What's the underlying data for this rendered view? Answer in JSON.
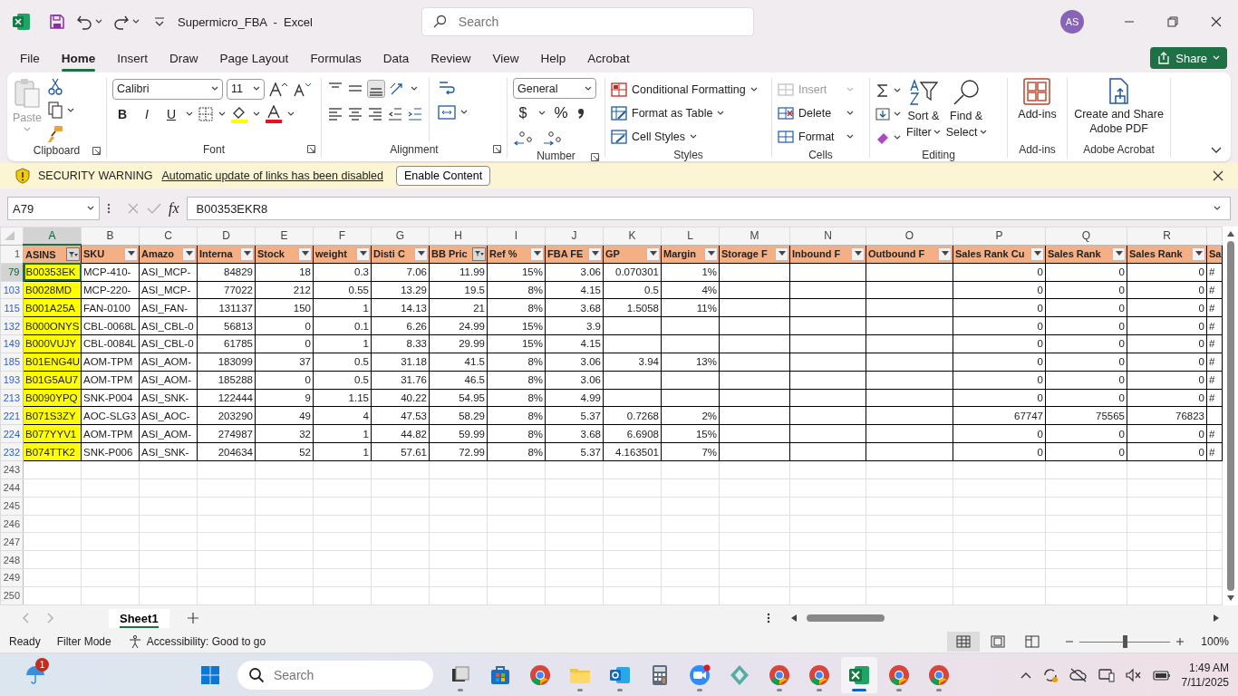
{
  "title_bar": {
    "title": "Supermicro_FBA  -  Excel",
    "search_placeholder": "Search",
    "avatar": "AS"
  },
  "menu_tabs": [
    {
      "label": "File",
      "selected": false
    },
    {
      "label": "Home",
      "selected": true
    },
    {
      "label": "Insert",
      "selected": false
    },
    {
      "label": "Draw",
      "selected": false
    },
    {
      "label": "Page Layout",
      "selected": false
    },
    {
      "label": "Formulas",
      "selected": false
    },
    {
      "label": "Data",
      "selected": false
    },
    {
      "label": "Review",
      "selected": false
    },
    {
      "label": "View",
      "selected": false
    },
    {
      "label": "Help",
      "selected": false
    },
    {
      "label": "Acrobat",
      "selected": false
    }
  ],
  "share_button": "Share",
  "ribbon": [
    {
      "kind": "clipboard",
      "label": "Clipboard",
      "paste": "Paste"
    },
    {
      "kind": "font",
      "label": "Font",
      "font_name": "Calibri",
      "font_size": "11",
      "bold": "B",
      "italic": "I",
      "underline": "U"
    },
    {
      "kind": "alignment",
      "label": "Alignment"
    },
    {
      "kind": "number",
      "label": "Number",
      "format": "General",
      "currency": "$",
      "percent": "%"
    },
    {
      "kind": "styles",
      "label": "Styles",
      "items": [
        "Conditional Formatting",
        "Format as Table",
        "Cell Styles"
      ]
    },
    {
      "kind": "cells",
      "label": "Cells",
      "items": [
        {
          "label": "Insert",
          "disabled": true
        },
        {
          "label": "Delete",
          "disabled": false
        },
        {
          "label": "Format",
          "disabled": false
        }
      ]
    },
    {
      "kind": "editing",
      "label": "Editing",
      "sort": [
        "Sort &",
        "Filter"
      ],
      "find": [
        "Find &",
        "Select"
      ]
    },
    {
      "kind": "addins",
      "label": "Add-ins",
      "button": "Add-ins"
    },
    {
      "kind": "acrobat",
      "label": "Adobe Acrobat",
      "button": "Create and Share Adobe PDF"
    }
  ],
  "security_warning": {
    "title": "SECURITY WARNING",
    "message": "Automatic update of links has been disabled",
    "button": "Enable Content"
  },
  "formula_bar": {
    "name_box": "A79",
    "function_label": "fx",
    "formula": "B00353EKR8"
  },
  "grid": {
    "header_row_number": "1",
    "columns": [
      {
        "letter": "A",
        "header": "ASINS",
        "kind": "text",
        "filtered": true,
        "highlighted": true,
        "selected": true
      },
      {
        "letter": "B",
        "header": "SKU",
        "kind": "text",
        "filtered": false,
        "highlighted": false,
        "selected": false
      },
      {
        "letter": "C",
        "header": "Amazo",
        "kind": "text",
        "filtered": false,
        "highlighted": false,
        "selected": false
      },
      {
        "letter": "D",
        "header": "Interna",
        "kind": "number",
        "filtered": false,
        "highlighted": false,
        "selected": false
      },
      {
        "letter": "E",
        "header": "Stock",
        "kind": "number",
        "filtered": false,
        "highlighted": false,
        "selected": false
      },
      {
        "letter": "F",
        "header": "weight",
        "kind": "number",
        "filtered": false,
        "highlighted": false,
        "selected": false
      },
      {
        "letter": "G",
        "header": "Disti C",
        "kind": "number",
        "filtered": false,
        "highlighted": false,
        "selected": false
      },
      {
        "letter": "H",
        "header": "BB Pric",
        "kind": "number",
        "filtered": true,
        "highlighted": false,
        "selected": false
      },
      {
        "letter": "I",
        "header": "Ref %",
        "kind": "number",
        "filtered": false,
        "highlighted": false,
        "selected": false
      },
      {
        "letter": "J",
        "header": "FBA FE",
        "kind": "number",
        "filtered": false,
        "highlighted": false,
        "selected": false
      },
      {
        "letter": "K",
        "header": "GP",
        "kind": "number",
        "filtered": false,
        "highlighted": false,
        "selected": false
      },
      {
        "letter": "L",
        "header": "Margin",
        "kind": "number",
        "filtered": false,
        "highlighted": false,
        "selected": false
      },
      {
        "letter": "M",
        "header": "Storage F",
        "kind": "number",
        "filtered": false,
        "highlighted": false,
        "selected": false
      },
      {
        "letter": "N",
        "header": "Inbound F",
        "kind": "number",
        "filtered": false,
        "highlighted": false,
        "selected": false
      },
      {
        "letter": "O",
        "header": "Outbound F",
        "kind": "number",
        "filtered": false,
        "highlighted": false,
        "selected": false
      },
      {
        "letter": "P",
        "header": "Sales Rank Cu",
        "kind": "number",
        "filtered": false,
        "highlighted": false,
        "selected": false
      },
      {
        "letter": "Q",
        "header": "Sales Rank",
        "kind": "number",
        "filtered": false,
        "highlighted": false,
        "selected": false
      },
      {
        "letter": "R",
        "header": "Sales Rank",
        "kind": "number",
        "filtered": false,
        "highlighted": false,
        "selected": false
      },
      {
        "header": "Sa",
        "kind": "text",
        "highlighted": false
      }
    ],
    "rows": [
      {
        "number": "79",
        "selected": true,
        "cells": [
          "B00353EK",
          "MCP-410-",
          "ASI_MCP-",
          "84829",
          "18",
          "0.3",
          "7.06",
          "11.99",
          "15%",
          "3.06",
          "0.070301",
          "1%",
          "",
          "",
          "",
          "0",
          "0",
          "0",
          "#"
        ]
      },
      {
        "number": "103",
        "selected": false,
        "cells": [
          "B0028MD",
          "MCP-220-",
          "ASI_MCP-",
          "77022",
          "212",
          "0.55",
          "13.29",
          "19.5",
          "8%",
          "4.15",
          "0.5",
          "4%",
          "",
          "",
          "",
          "0",
          "0",
          "0",
          "#"
        ]
      },
      {
        "number": "115",
        "selected": false,
        "cells": [
          "B001A25A",
          "FAN-0100",
          "ASI_FAN-",
          "131137",
          "150",
          "1",
          "14.13",
          "21",
          "8%",
          "3.68",
          "1.5058",
          "11%",
          "",
          "",
          "",
          "0",
          "0",
          "0",
          "#"
        ]
      },
      {
        "number": "132",
        "selected": false,
        "cells": [
          "B000ONYS",
          "CBL-0068L",
          "ASI_CBL-0",
          "56813",
          "0",
          "0.1",
          "6.26",
          "24.99",
          "15%",
          "3.9",
          "",
          "",
          "",
          "",
          "",
          "0",
          "0",
          "0",
          "#"
        ]
      },
      {
        "number": "149",
        "selected": false,
        "cells": [
          "B000VUJY",
          "CBL-0084L",
          "ASI_CBL-0",
          "61785",
          "0",
          "1",
          "8.33",
          "29.99",
          "15%",
          "4.15",
          "",
          "",
          "",
          "",
          "",
          "0",
          "0",
          "0",
          "#"
        ]
      },
      {
        "number": "185",
        "selected": false,
        "cells": [
          "B01ENG4U",
          "AOM-TPM",
          "ASI_AOM-",
          "183099",
          "37",
          "0.5",
          "31.18",
          "41.5",
          "8%",
          "3.06",
          "3.94",
          "13%",
          "",
          "",
          "",
          "0",
          "0",
          "0",
          "#"
        ]
      },
      {
        "number": "193",
        "selected": false,
        "cells": [
          "B01G5AU7",
          "AOM-TPM",
          "ASI_AOM-",
          "185288",
          "0",
          "0.5",
          "31.76",
          "46.5",
          "8%",
          "3.06",
          "",
          "",
          "",
          "",
          "",
          "0",
          "0",
          "0",
          "#"
        ]
      },
      {
        "number": "213",
        "selected": false,
        "cells": [
          "B0090YPQ",
          "SNK-P004",
          "ASI_SNK-",
          "122444",
          "9",
          "1.15",
          "40.22",
          "54.95",
          "8%",
          "4.99",
          "",
          "",
          "",
          "",
          "",
          "0",
          "0",
          "0",
          "#"
        ]
      },
      {
        "number": "221",
        "selected": false,
        "cells": [
          "B071S3ZY",
          "AOC-SLG3",
          "ASI_AOC-",
          "203290",
          "49",
          "4",
          "47.53",
          "58.29",
          "8%",
          "5.37",
          "0.7268",
          "2%",
          "",
          "",
          "",
          "67747",
          "75565",
          "76823",
          ""
        ]
      },
      {
        "number": "224",
        "selected": false,
        "cells": [
          "B077YYV1",
          "AOM-TPM",
          "ASI_AOM-",
          "274987",
          "32",
          "1",
          "44.82",
          "59.99",
          "8%",
          "3.68",
          "6.6908",
          "15%",
          "",
          "",
          "",
          "0",
          "0",
          "0",
          "#"
        ]
      },
      {
        "number": "232",
        "selected": false,
        "cells": [
          "B074TTK2",
          "SNK-P006",
          "ASI_SNK-",
          "204634",
          "52",
          "1",
          "57.61",
          "72.99",
          "8%",
          "5.37",
          "4.163501",
          "7%",
          "",
          "",
          "",
          "0",
          "0",
          "0",
          "#"
        ]
      }
    ],
    "empty_rows": [
      "243",
      "244",
      "245",
      "246",
      "247",
      "248",
      "249",
      "250"
    ]
  },
  "sheet_tabs": [
    {
      "label": "Sheet1",
      "selected": true
    }
  ],
  "status_bar": {
    "mode": "Ready",
    "filter": "Filter Mode",
    "accessibility": "Accessibility: Good to go",
    "views": [
      {
        "kind": "normal",
        "selected": true
      },
      {
        "kind": "page_layout",
        "selected": false
      },
      {
        "kind": "page_break",
        "selected": false
      }
    ],
    "zoom_slider": {
      "level": 0.5
    },
    "zoom": "100%"
  },
  "taskbar": {
    "weather_badge": "1",
    "search_placeholder": "Search",
    "apps": [
      {
        "kind": "task_view",
        "running": true,
        "selected": false
      },
      {
        "kind": "store",
        "running": false,
        "selected": false
      },
      {
        "kind": "chrome",
        "running": false,
        "selected": false
      },
      {
        "kind": "explorer",
        "running": true,
        "selected": false
      },
      {
        "kind": "outlook",
        "running": true,
        "selected": false
      },
      {
        "kind": "calculator",
        "running": false,
        "selected": false
      },
      {
        "kind": "zoom",
        "running": true,
        "selected": false
      },
      {
        "kind": "app",
        "running": false,
        "selected": false
      },
      {
        "kind": "chrome",
        "running": true,
        "selected": false
      },
      {
        "kind": "chrome",
        "running": true,
        "selected": false
      },
      {
        "kind": "excel",
        "running": true,
        "selected": true
      },
      {
        "kind": "chrome",
        "running": true,
        "selected": false
      },
      {
        "kind": "chrome",
        "running": true,
        "selected": false
      }
    ],
    "time": "1:49 AM",
    "date": "7/11/2025"
  }
}
